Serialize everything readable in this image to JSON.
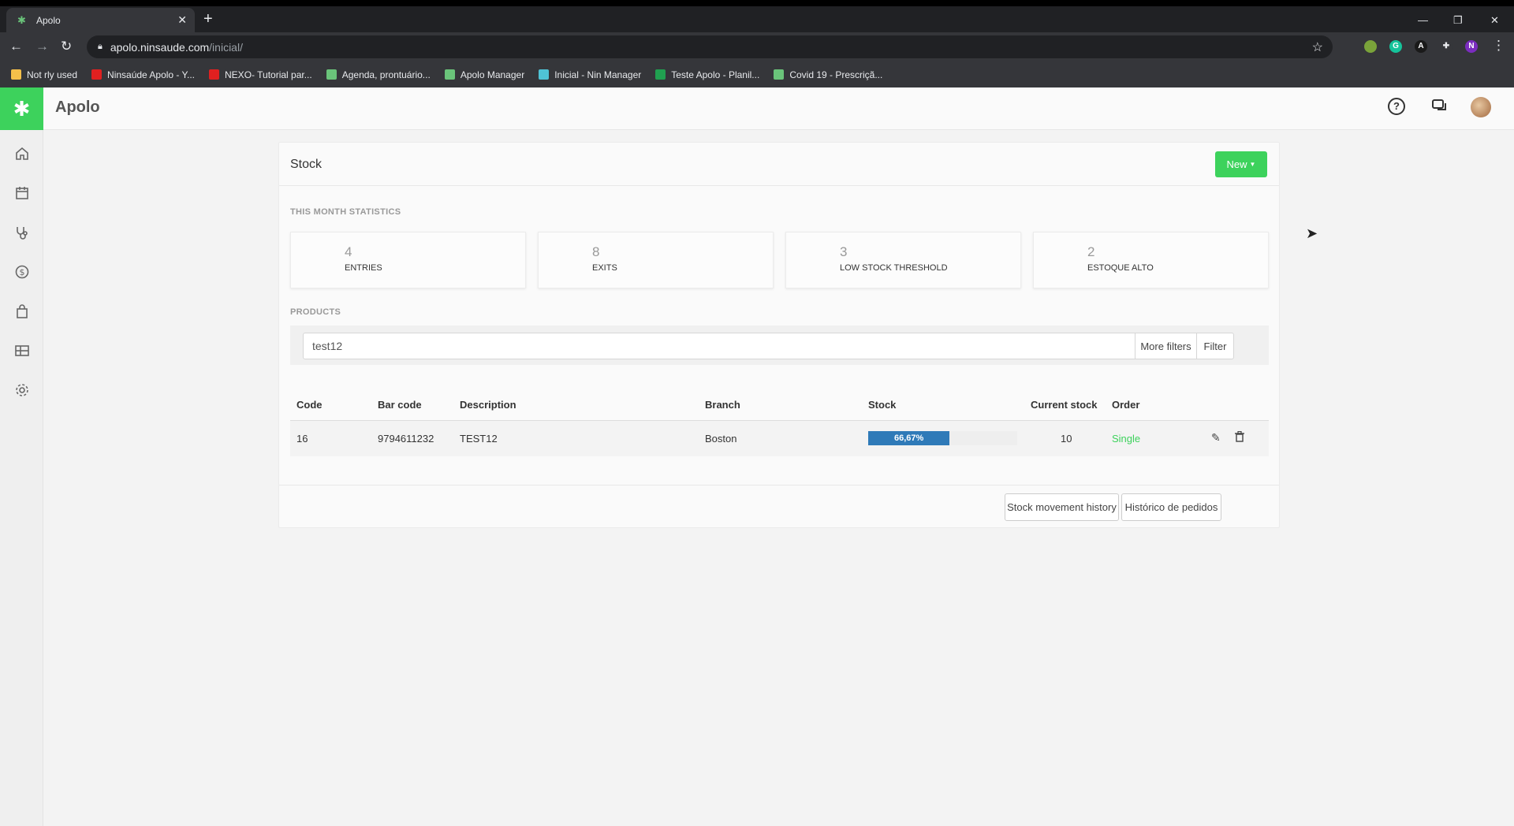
{
  "browser": {
    "tab_title": "Apolo",
    "tab_close": "✕",
    "new_tab": "+",
    "url_domain": "apolo.ninsaude.com",
    "url_path": "/inicial/",
    "bookmarks": [
      {
        "label": "Not rly used",
        "color": "#f5c04a"
      },
      {
        "label": "Ninsaúde Apolo - Y...",
        "color": "#e02020"
      },
      {
        "label": "NEXO- Tutorial par...",
        "color": "#e02020"
      },
      {
        "label": "Agenda, prontuário...",
        "color": "#6ac47a"
      },
      {
        "label": "Apolo Manager",
        "color": "#6ac47a"
      },
      {
        "label": "Inicial - Nin Manager",
        "color": "#4fc3d6"
      },
      {
        "label": "Teste Apolo - Planil...",
        "color": "#20a050"
      },
      {
        "label": "Covid 19 - Prescriçã...",
        "color": "#6ac47a"
      }
    ],
    "extensions": [
      {
        "letter": "",
        "color": "#7aa33a"
      },
      {
        "letter": "G",
        "color": "#15c39a"
      },
      {
        "letter": "A",
        "color": "#1a1a1a"
      },
      {
        "letter": "",
        "color": "#35363a"
      },
      {
        "letter": "N",
        "color": "#7b2cbf"
      }
    ]
  },
  "app": {
    "title": "Apolo",
    "help_symbol": "?"
  },
  "stock": {
    "title": "Stock",
    "new_button": "New",
    "stats_heading": "THIS MONTH STATISTICS",
    "stats": [
      {
        "value": "4",
        "label": "ENTRIES"
      },
      {
        "value": "8",
        "label": "EXITS"
      },
      {
        "value": "3",
        "label": "LOW STOCK THRESHOLD"
      },
      {
        "value": "2",
        "label": "ESTOQUE ALTO"
      }
    ],
    "products_heading": "PRODUCTS",
    "search_value": "test12",
    "more_filters": "More filters",
    "filter": "Filter",
    "columns": [
      "Code",
      "Bar code",
      "Description",
      "Branch",
      "Stock",
      "Current stock",
      "Order"
    ],
    "row": {
      "code": "16",
      "barcode": "9794611232",
      "description": "TEST12",
      "branch": "Boston",
      "stock_label": "66,67%",
      "stock_fraction": 0.6667,
      "current_stock": "10",
      "order": "Single"
    },
    "history_button": "Stock movement history",
    "orders_button": "Histórico de pedidos"
  }
}
